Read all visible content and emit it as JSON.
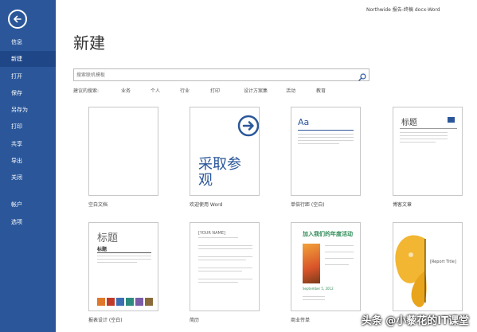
{
  "window": {
    "title": "Northwide 报告-终稿 docx-Word"
  },
  "sidebar": {
    "items": [
      {
        "label": "信息"
      },
      {
        "label": "新建"
      },
      {
        "label": "打开"
      },
      {
        "label": "保存"
      },
      {
        "label": "另存为"
      },
      {
        "label": "打印"
      },
      {
        "label": "共享"
      },
      {
        "label": "导出"
      },
      {
        "label": "关闭"
      },
      {
        "label": "帐户"
      },
      {
        "label": "选项"
      }
    ],
    "active_index": 1,
    "color": "#2b579a"
  },
  "page": {
    "title": "新建"
  },
  "search": {
    "placeholder": "搜索联机模板"
  },
  "suggested": {
    "label": "建议的搜索:",
    "links": [
      "业务",
      "个人",
      "行业",
      "打印",
      "设计方案集",
      "活动",
      "教育"
    ]
  },
  "templates": [
    {
      "label": "空白文档"
    },
    {
      "label": "欢迎使用 Word",
      "thumb_text": "采取参观"
    },
    {
      "label": "单倍行距 (空白)",
      "thumb_text": "Aa"
    },
    {
      "label": "博客文章",
      "thumb_text": "标题"
    },
    {
      "label": "报表设计 (空白)",
      "thumb_title": "标题",
      "thumb_subtitle": "标题"
    },
    {
      "label": "简历",
      "thumb_text": "[YOUR NAME]"
    },
    {
      "label": "商业传单",
      "thumb_title": "加入我们的年度活动",
      "thumb_date": "September 5, 2012"
    },
    {
      "label": "",
      "thumb_text": "[Report Title]"
    }
  ],
  "watermark": "头条 @小藜花的IT课堂"
}
